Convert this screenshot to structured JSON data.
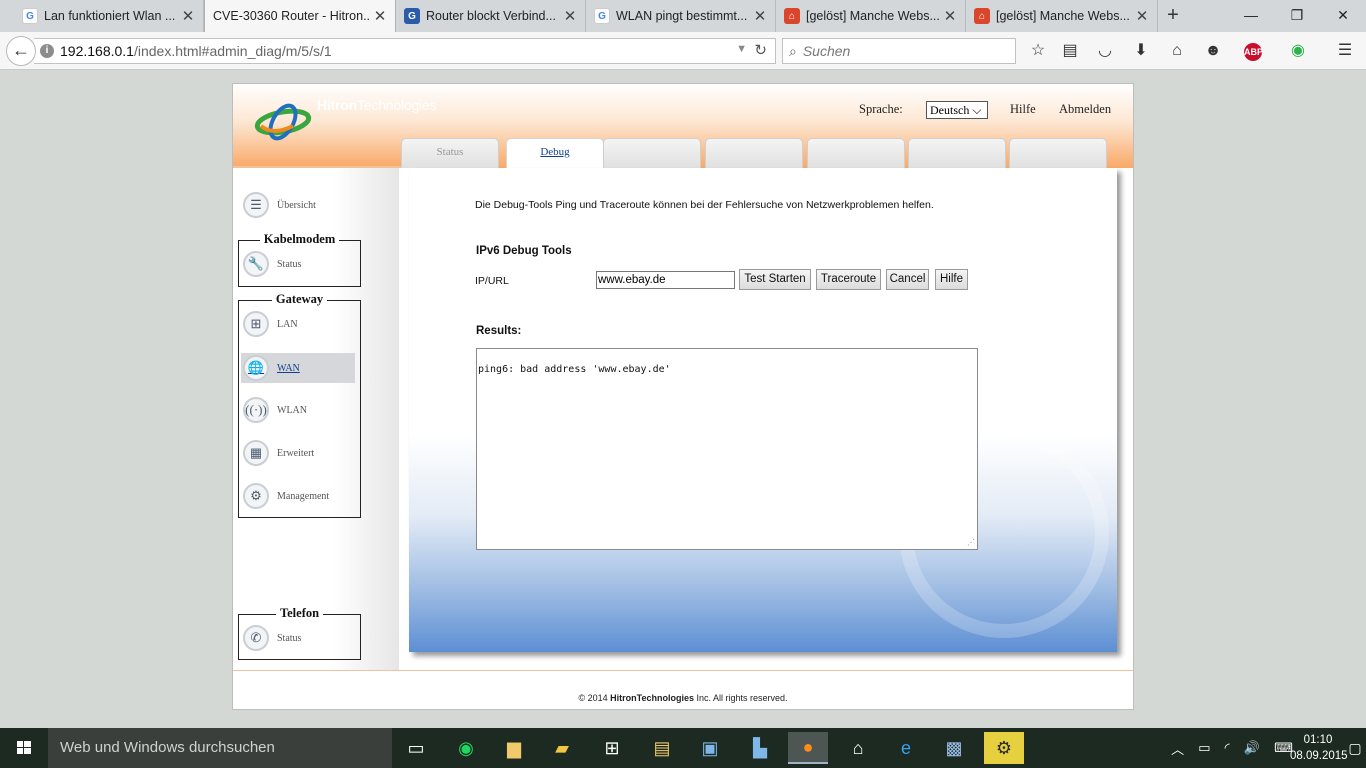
{
  "browser": {
    "tabs": [
      {
        "title": "Lan funktioniert Wlan ...",
        "favicon": "G",
        "favicon_color": "#4285f4"
      },
      {
        "title": "CVE-30360 Router - Hitron...",
        "favicon": "",
        "favicon_color": ""
      },
      {
        "title": "Router blockt Verbind...",
        "favicon": "G",
        "favicon_color": "#2a5caa"
      },
      {
        "title": "WLAN pingt bestimmt...",
        "favicon": "G",
        "favicon_color": "#4285f4"
      },
      {
        "title": "[gelöst] Manche Webs...",
        "favicon": "⌂",
        "favicon_color": "#d9462b"
      },
      {
        "title": "[gelöst] Manche Webs...",
        "favicon": "⌂",
        "favicon_color": "#d9462b"
      }
    ],
    "new_tab_icon": "+",
    "url_host": "192.168.0.1",
    "url_path": "/index.html#admin_diag/m/5/s/1",
    "search_placeholder": "Suchen",
    "abp_label": "ABP"
  },
  "router": {
    "brand_bold": "Hitron",
    "brand_rest": "Technologies",
    "language_label": "Sprache:",
    "language_value": "Deutsch",
    "help": "Hilfe",
    "logout": "Abmelden",
    "tabs": [
      "Status",
      "Debug",
      "",
      "",
      "",
      "",
      ""
    ],
    "active_tab": "Debug",
    "menu": {
      "overview": "Übersicht",
      "groups": [
        {
          "title": "Kabelmodem",
          "items": [
            "Status"
          ]
        },
        {
          "title": "Gateway",
          "items": [
            "LAN",
            "WAN",
            "WLAN",
            "Erweitert",
            "Management"
          ]
        },
        {
          "title": "Telefon",
          "items": [
            "Status"
          ]
        }
      ],
      "selected": "WAN"
    },
    "content": {
      "description": "Die Debug-Tools Ping und Traceroute können bei der Fehlersuche von Netzwerkproblemen helfen.",
      "section_title": "IPv6 Debug Tools",
      "ip_label": "IP/URL",
      "ip_value": "www.ebay.de",
      "buttons": [
        "Test Starten",
        "Traceroute",
        "Cancel",
        "Hilfe"
      ],
      "results_label": "Results:",
      "results_text": "ping6: bad address 'www.ebay.de'"
    },
    "footer_prefix": "© 2014",
    "footer_brand": "HitronTechnologies",
    "footer_suffix": "Inc.  All rights reserved."
  },
  "taskbar": {
    "search_placeholder": "Web und Windows durchsuchen",
    "time": "01:10",
    "date": "08.09.2015"
  },
  "colors": {
    "header_orange": "#f9a866",
    "panel_blue": "#5d8fd4",
    "link_blue": "#113f8c",
    "taskbar": "#1d2a21"
  }
}
